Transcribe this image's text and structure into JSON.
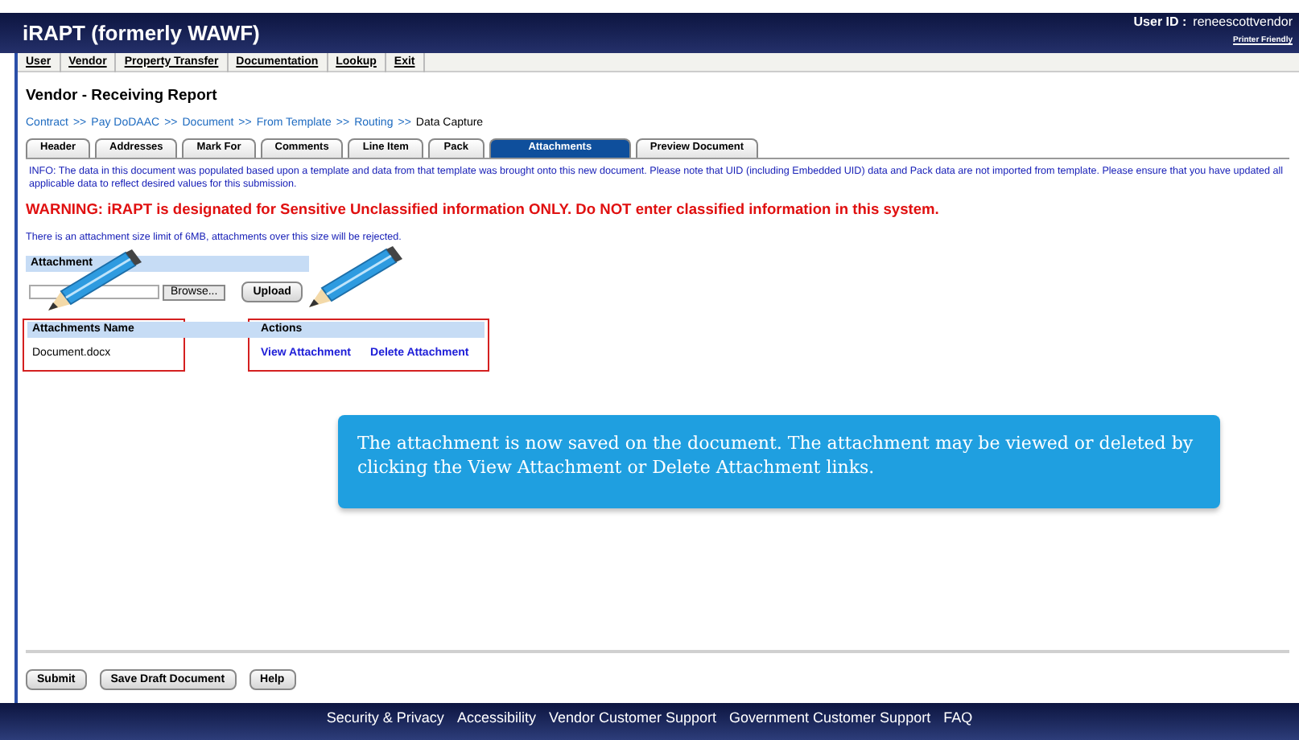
{
  "header": {
    "title": "iRAPT (formerly WAWF)",
    "user_label": "User ID :",
    "user_id": "reneescottvendor",
    "printer_link": "Printer Friendly"
  },
  "menu": [
    "User",
    "Vendor",
    "Property Transfer",
    "Documentation",
    "Lookup",
    "Exit"
  ],
  "page_title": "Vendor - Receiving Report",
  "breadcrumb": {
    "links": [
      "Contract",
      ">>",
      "Pay DoDAAC",
      ">>",
      "Document",
      ">>",
      "From Template",
      ">>",
      "Routing",
      ">>"
    ],
    "current": "Data Capture"
  },
  "tabs": [
    {
      "label": "Header",
      "selected": false
    },
    {
      "label": "Addresses",
      "selected": false
    },
    {
      "label": "Mark For",
      "selected": false
    },
    {
      "label": "Comments",
      "selected": false
    },
    {
      "label": "Line Item",
      "selected": false
    },
    {
      "label": "Pack",
      "selected": false
    },
    {
      "label": "Attachments",
      "selected": true
    },
    {
      "label": "Preview Document",
      "selected": false
    }
  ],
  "info": "INFO: The data in this document was populated based upon a template and data from that template was brought onto this new document. Please note that UID (including Embedded UID) data and Pack data are not imported from template. Please ensure that you have updated all applicable data to reflect desired values for this submission.",
  "warning": "WARNING: iRAPT is designated for Sensitive Unclassified information ONLY. Do NOT enter classified information in this system.",
  "size_note": "There is an attachment size limit of 6MB, attachments over this size will be rejected.",
  "attachment": {
    "heading": "Attachment",
    "browse": "Browse...",
    "upload": "Upload"
  },
  "table": {
    "columns": [
      "Attachments Name",
      "Actions"
    ],
    "rows": [
      {
        "name": "Document.docx",
        "actions": [
          "View Attachment",
          "Delete Attachment"
        ]
      }
    ]
  },
  "callout": "The attachment is now saved on the document. The attachment may be viewed or deleted by clicking the View Attachment or Delete Attachment links.",
  "buttons": [
    "Submit",
    "Save Draft Document",
    "Help"
  ],
  "footer": [
    "Security & Privacy",
    "Accessibility",
    "Vendor Customer Support",
    "Government Customer Support",
    "FAQ"
  ]
}
